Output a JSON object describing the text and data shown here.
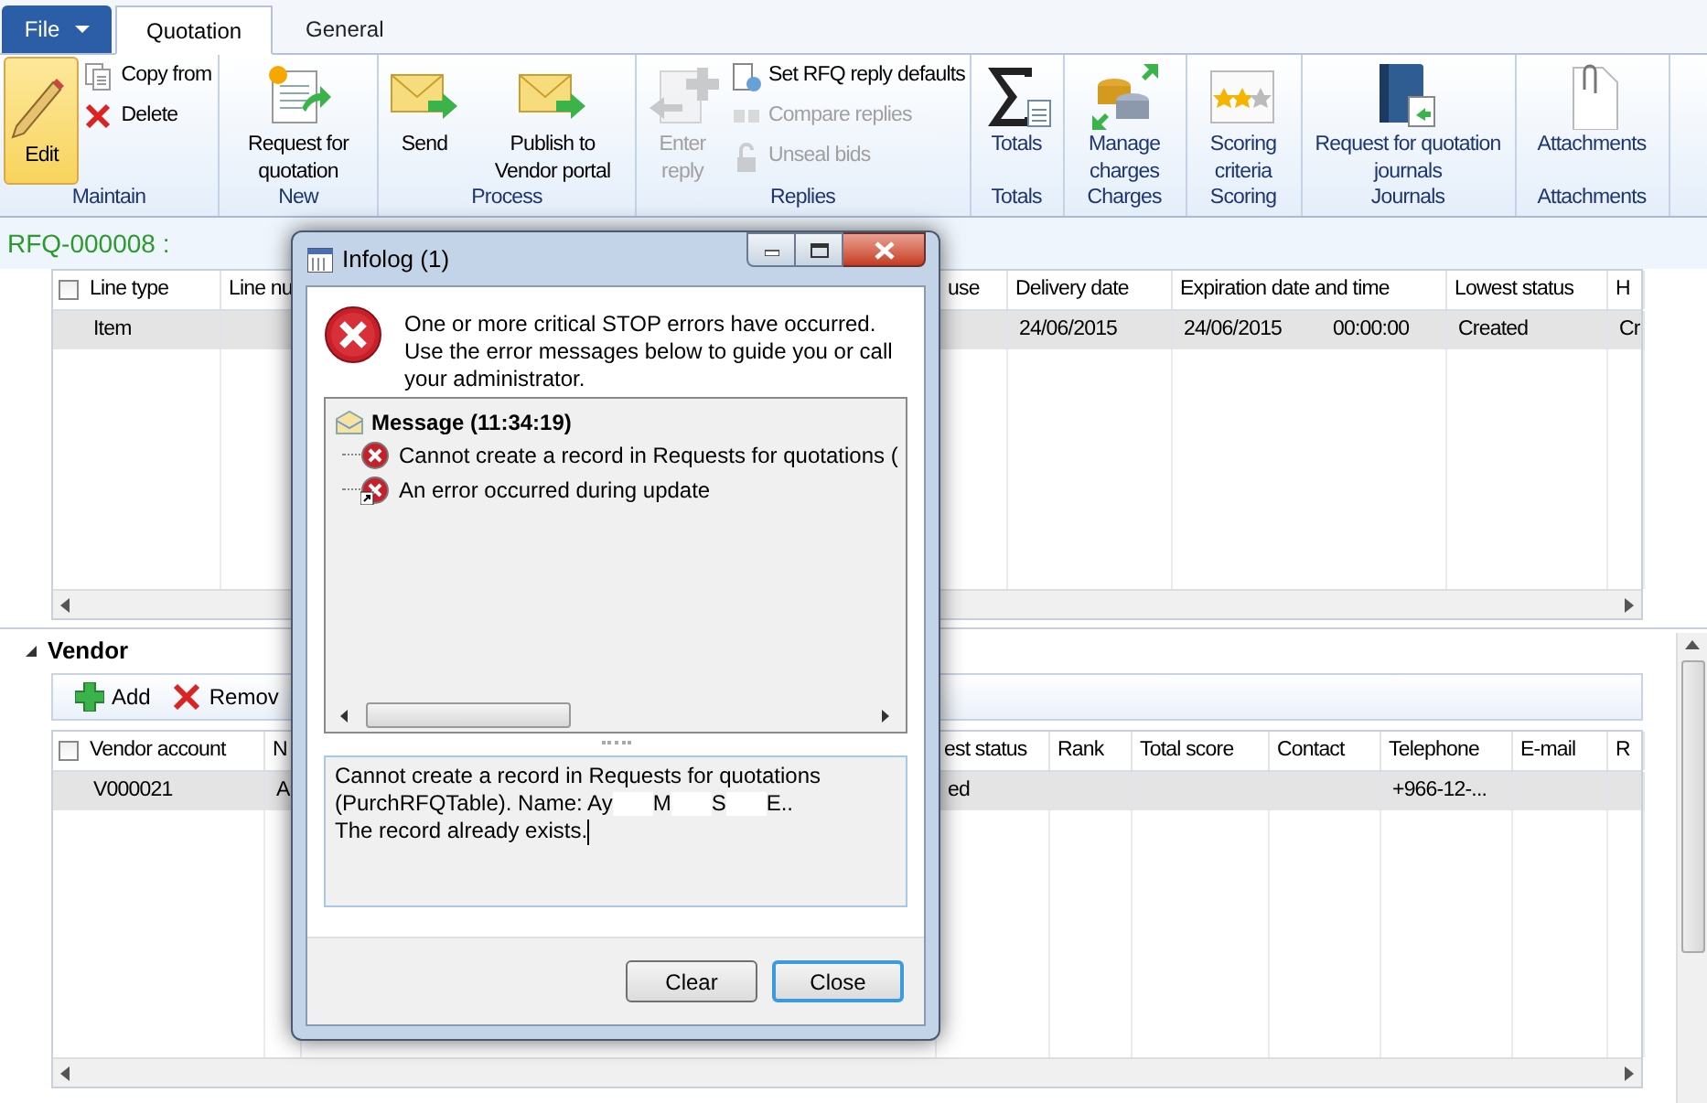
{
  "ribbon": {
    "file_menu": "File",
    "tabs": [
      {
        "label": "Quotation",
        "selected": true
      },
      {
        "label": "General",
        "selected": false
      }
    ],
    "groups": [
      {
        "label": "Maintain",
        "items": [
          {
            "kind": "large",
            "label": "Edit",
            "pressed": true,
            "disabled": false
          },
          {
            "kind": "small",
            "label": "Copy from",
            "pressed": false,
            "disabled": false
          },
          {
            "kind": "small",
            "label": "Delete",
            "pressed": false,
            "disabled": false
          }
        ]
      },
      {
        "label": "New",
        "items": [
          {
            "kind": "large",
            "label": "Request for quotation",
            "pressed": false,
            "disabled": false
          }
        ]
      },
      {
        "label": "Process",
        "items": [
          {
            "kind": "large",
            "label": "Send",
            "pressed": false,
            "disabled": false
          },
          {
            "kind": "large",
            "label": "Publish to Vendor portal",
            "pressed": false,
            "disabled": false
          }
        ]
      },
      {
        "label": "Replies",
        "items": [
          {
            "kind": "large",
            "label": "Enter reply",
            "pressed": false,
            "disabled": true
          },
          {
            "kind": "small",
            "label": "Set RFQ reply defaults",
            "pressed": false,
            "disabled": false
          },
          {
            "kind": "small",
            "label": "Compare replies",
            "pressed": false,
            "disabled": true
          },
          {
            "kind": "small",
            "label": "Unseal bids",
            "pressed": false,
            "disabled": true
          }
        ]
      },
      {
        "label": "Totals",
        "items": [
          {
            "kind": "large",
            "label": "Totals",
            "pressed": false,
            "disabled": false
          }
        ]
      },
      {
        "label": "Charges",
        "items": [
          {
            "kind": "large",
            "label": "Manage charges",
            "pressed": false,
            "disabled": false
          }
        ]
      },
      {
        "label": "Scoring",
        "items": [
          {
            "kind": "large",
            "label": "Scoring criteria",
            "pressed": false,
            "disabled": false
          }
        ]
      },
      {
        "label": "Journals",
        "items": [
          {
            "kind": "large",
            "label": "Request for quotation journals",
            "pressed": false,
            "disabled": false
          }
        ]
      },
      {
        "label": "Attachments",
        "items": [
          {
            "kind": "large",
            "label": "Attachments",
            "pressed": false,
            "disabled": false
          }
        ]
      }
    ]
  },
  "record_title": "RFQ-000008 :",
  "lines_grid": {
    "select_all_checked": false,
    "columns": [
      "Line type",
      "Line nu",
      "use",
      "Delivery date",
      "Expiration date and time",
      "Lowest status",
      "H"
    ],
    "rows": [
      {
        "selected": true,
        "cells": [
          "Item",
          "",
          "",
          "24/06/2015",
          "24/06/2015          00:00:00",
          "Created",
          "Cr"
        ]
      }
    ]
  },
  "vendor_section": {
    "title": "Vendor",
    "expanded": true,
    "select_all_checked": false,
    "toolbar": [
      {
        "kind": "add",
        "label": "Add"
      },
      {
        "kind": "remove",
        "label": "Remov"
      }
    ],
    "columns": [
      "Vendor account",
      "N",
      "est status",
      "Rank",
      "Total score",
      "Contact",
      "Telephone",
      "E-mail",
      "R"
    ],
    "rows": [
      {
        "selected": true,
        "cells": [
          "V000021",
          "A",
          "ed",
          "",
          "",
          "",
          "+966-12-...",
          "",
          ""
        ]
      }
    ]
  },
  "dialog": {
    "title": "Infolog (1)",
    "summary": "One or more critical STOP errors have occurred. Use the error messages below to guide you or call your administrator.",
    "tree": {
      "label": "Message (11:34:19)",
      "children": [
        {
          "kind": "error",
          "text": "Cannot create a record in Requests for quotations ("
        },
        {
          "kind": "error_link",
          "text": "An error occurred during update"
        }
      ]
    },
    "detail": {
      "line_1": "Cannot create a record in Requests for quotations",
      "line_2_fragments": [
        "(PurchRFQTable). Name: Ay",
        "M",
        "S",
        "E.."
      ],
      "line_3": "The record already exists."
    },
    "buttons": [
      {
        "label": "Clear",
        "default": false
      },
      {
        "label": "Close",
        "default": true
      }
    ]
  }
}
